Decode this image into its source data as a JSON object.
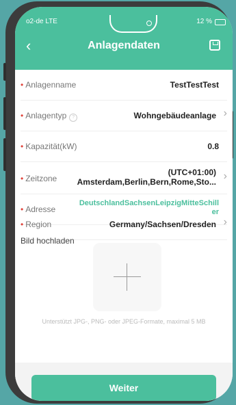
{
  "status": {
    "carrier": "o2-de LTE",
    "battery": "12 %"
  },
  "header": {
    "title": "Anlagendaten"
  },
  "fields": [
    {
      "label": "Anlagenname",
      "value": "TestTestTest"
    },
    {
      "label": "Anlagentyp",
      "value": "Wohngebäudeanlage"
    },
    {
      "label": "Kapazität(kW)",
      "value": "0.8"
    },
    {
      "label": "Zeitzone",
      "value_line1": "(UTC+01:00)",
      "value_line2": "Amsterdam,Berlin,Bern,Rome,Sto..."
    },
    {
      "label": "Adresse",
      "value_line1": "DeutschlandSachsenLeipzigMitteSchill",
      "value_line2": "er"
    },
    {
      "label": "Region",
      "value": "Germany/Sachsen/Dresden"
    }
  ],
  "upload": {
    "title": "Bild hochladen",
    "hint": "Unterstützt JPG-, PNG- oder JPEG-Formate, maximal 5 MB"
  },
  "footer": {
    "button": "Weiter"
  },
  "colors": {
    "accent": "#4bbf9d",
    "required": "#e0433a",
    "address": "#4bbf9d"
  }
}
